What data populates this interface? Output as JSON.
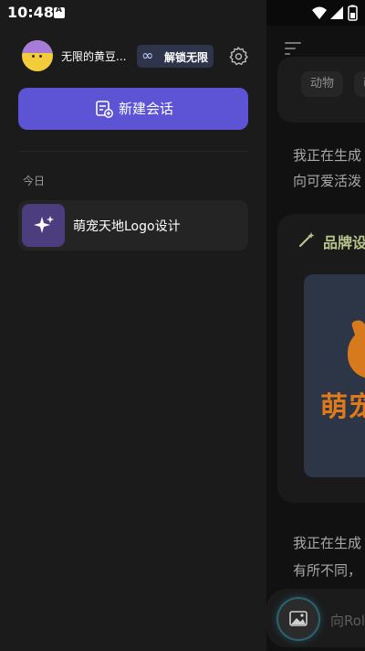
{
  "status_bar": {
    "time": "10:48"
  },
  "profile": {
    "username": "无限的黄豆...",
    "unlock_label": "解锁无限"
  },
  "new_chat_label": "新建会话",
  "history": {
    "section_label": "今日",
    "items": [
      {
        "title": "萌宠天地Logo设计"
      }
    ]
  },
  "background_chat": {
    "chip_1": "动物",
    "chip_2": "萌",
    "message_1_line_1": "我正在生成",
    "message_1_line_2": "向可爱活泼",
    "card_title": "品牌设",
    "image_logo_text": "萌宠",
    "message_2_line_1": "我正在生成",
    "message_2_line_2": "有所不同，",
    "input_placeholder": "向Role"
  },
  "colors": {
    "accent": "#5c54d4",
    "drawer_bg": "#1b1b1b",
    "unlock_bg": "#2e344a"
  }
}
